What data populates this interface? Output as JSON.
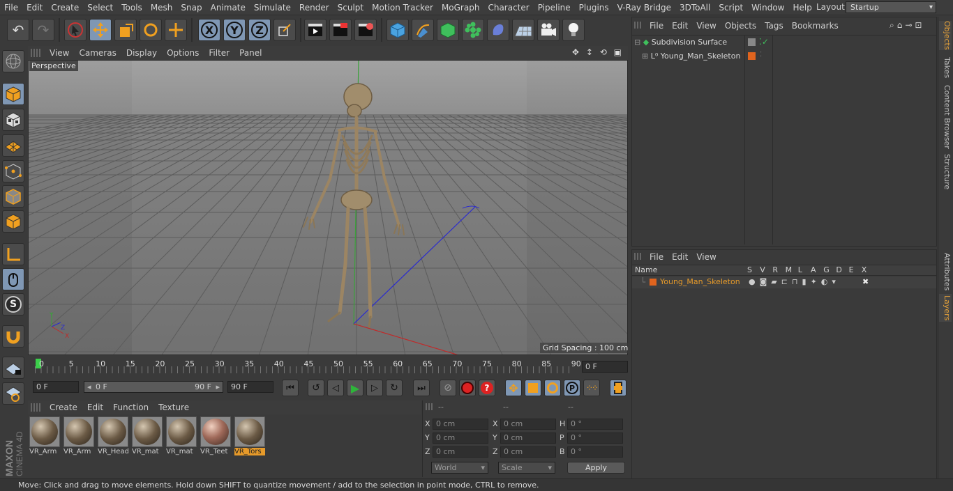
{
  "menubar": {
    "items": [
      "File",
      "Edit",
      "Create",
      "Select",
      "Tools",
      "Mesh",
      "Snap",
      "Animate",
      "Simulate",
      "Render",
      "Sculpt",
      "Motion Tracker",
      "MoGraph",
      "Character",
      "Pipeline",
      "Plugins",
      "V-Ray Bridge",
      "3DToAll",
      "Script",
      "Window",
      "Help"
    ],
    "layout_label": "Layout:",
    "layout_value": "Startup"
  },
  "viewport": {
    "menu": [
      "View",
      "Cameras",
      "Display",
      "Options",
      "Filter",
      "Panel"
    ],
    "camera_label": "Perspective",
    "grid_spacing": "Grid Spacing : 100 cm",
    "axis": {
      "x": "X",
      "y": "Y",
      "z": "Z"
    }
  },
  "timeline": {
    "ticks": [
      "0",
      "5",
      "10",
      "15",
      "20",
      "25",
      "30",
      "35",
      "40",
      "45",
      "50",
      "55",
      "60",
      "65",
      "70",
      "75",
      "80",
      "85",
      "90"
    ],
    "current_frame": "0 F"
  },
  "playback": {
    "start": "0 F",
    "range_start": "0 F",
    "range_end": "90 F",
    "end": "90 F"
  },
  "materials": {
    "menu": [
      "Create",
      "Edit",
      "Function",
      "Texture"
    ],
    "items": [
      {
        "label": "VR_Arm"
      },
      {
        "label": "VR_Arm"
      },
      {
        "label": "VR_Head"
      },
      {
        "label": "VR_mat"
      },
      {
        "label": "VR_mat"
      },
      {
        "label": "VR_Teet"
      },
      {
        "label": "VR_Tors"
      }
    ]
  },
  "coords": {
    "headers": [
      "--",
      "--",
      "--"
    ],
    "rows": [
      {
        "a": "X",
        "av": "0 cm",
        "b": "X",
        "bv": "0 cm",
        "c": "H",
        "cv": "0 °"
      },
      {
        "a": "Y",
        "av": "0 cm",
        "b": "Y",
        "bv": "0 cm",
        "c": "P",
        "cv": "0 °"
      },
      {
        "a": "Z",
        "av": "0 cm",
        "b": "Z",
        "bv": "0 cm",
        "c": "B",
        "cv": "0 °"
      }
    ],
    "world": "World",
    "scale": "Scale",
    "apply": "Apply"
  },
  "objects": {
    "menu": [
      "File",
      "Edit",
      "View",
      "Objects",
      "Tags",
      "Bookmarks"
    ],
    "items": [
      {
        "name": "Subdivision Surface"
      },
      {
        "name": "Young_Man_Skeleton"
      }
    ]
  },
  "layers": {
    "menu": [
      "File",
      "Edit",
      "View"
    ],
    "name_header": "Name",
    "columns": [
      "S",
      "V",
      "R",
      "M",
      "L",
      "A",
      "G",
      "D",
      "E",
      "X"
    ],
    "items": [
      {
        "name": "Young_Man_Skeleton",
        "color": "#e0641e"
      }
    ]
  },
  "side_tabs": [
    "Objects",
    "Takes",
    "Content Browser",
    "Structure",
    "Attributes",
    "Layers"
  ],
  "status": "Move: Click and drag to move elements. Hold down SHIFT to quantize movement / add to the selection in point mode, CTRL to remove.",
  "brand": {
    "maxon": "MAXON",
    "cinema": "CINEMA 4D"
  },
  "colors": {
    "accent": "#e69a2a",
    "highlight": "#7f97b4",
    "layer_color": "#e0641e"
  }
}
